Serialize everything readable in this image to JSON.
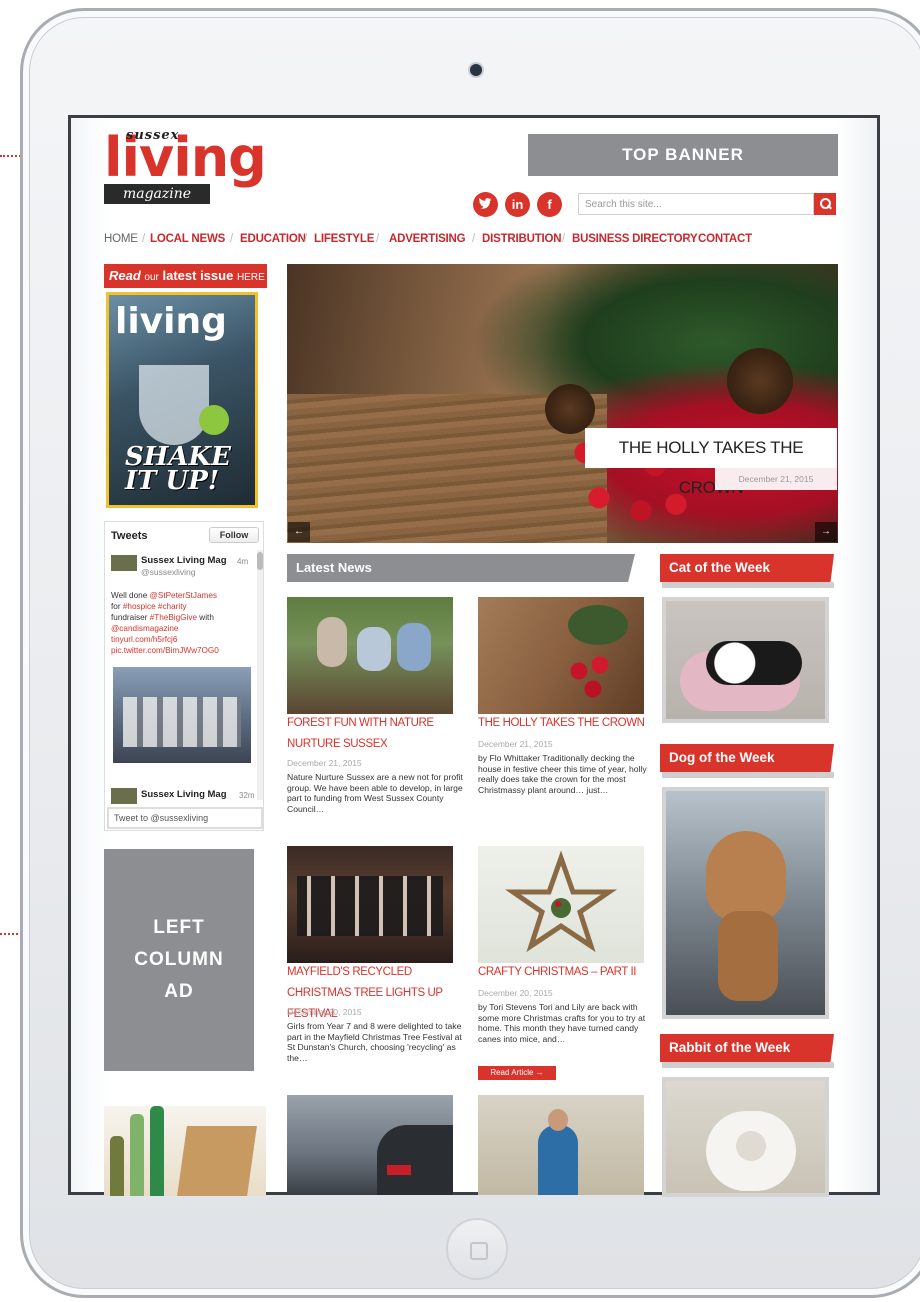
{
  "callouts": {
    "top_banner": "TOP BANNER",
    "left_column_ad": "LEFT\nCOLUMN\nAD"
  },
  "logo": {
    "sussex": "sussex",
    "living": "living",
    "magazine": "magazine"
  },
  "social": {
    "twitter_icon": "twitter-icon",
    "linkedin_icon": "linkedin-icon",
    "facebook_icon": "facebook-icon"
  },
  "search": {
    "placeholder": "Search this site..."
  },
  "nav": {
    "items": [
      "HOME",
      "LOCAL NEWS",
      "EDUCATION",
      "LIFESTYLE",
      "ADVERTISING",
      "DISTRIBUTION",
      "BUSINESS DIRECTORY",
      "CONTACT"
    ],
    "separator": "/"
  },
  "issue": {
    "read": "Read",
    "our": "our",
    "latest_issue": "latest issue",
    "here": "HERE",
    "cover_title": "living",
    "cover_shake": "SHAKE IT UP!"
  },
  "tweets": {
    "heading": "Tweets",
    "follow": "Follow",
    "tweet1_name": "Sussex Living Mag",
    "tweet1_time": "4m",
    "tweet1_handle": "@sussexliving",
    "tweet1_text_a": "Well done ",
    "tweet1_link1": "@StPeterStJames",
    "tweet1_text_b": "for ",
    "tweet1_link2": "#hospice #charity",
    "tweet1_text_c": "fundraiser ",
    "tweet1_link3": "#TheBigGive",
    "tweet1_text_d": " with",
    "tweet1_link4": "@candismagazine",
    "tweet1_link5": "tinyurl.com/h5rfcj6",
    "tweet1_link6": "pic.twitter.com/BimJWw7OG0",
    "tweet2_name": "Sussex Living Mag",
    "tweet2_time": "32m",
    "tweet_to": "Tweet to @sussexliving"
  },
  "hero": {
    "title": "THE HOLLY TAKES THE CROWN",
    "date": "December 21, 2015",
    "prev": "←",
    "next": "→"
  },
  "sections": {
    "latest_news": "Latest News",
    "cat": "Cat of the Week",
    "dog": "Dog of the Week",
    "rabbit": "Rabbit of the Week"
  },
  "articles": [
    {
      "title": "FOREST FUN WITH NATURE NURTURE SUSSEX",
      "date": "December 21, 2015",
      "excerpt": "Nature Nurture Sussex are a new not for profit group. We have been able to develop, in large part to funding from West Sussex County Council…"
    },
    {
      "title": "THE HOLLY TAKES THE CROWN",
      "date": "December 21, 2015",
      "excerpt": "by Flo Whittaker Traditionally decking the house in festive cheer this time of year, holly really does take the crown for the most Christmassy plant around… just…"
    },
    {
      "title": "MAYFIELD'S RECYCLED CHRISTMAS TREE LIGHTS UP FESTIVAL",
      "date": "December 20, 2015",
      "excerpt": "Girls from Year 7 and 8 were delighted to take part in the Mayfield Christmas Tree Festival at St Dunstan's Church, choosing 'recycling' as the…"
    },
    {
      "title": "CRAFTY CHRISTMAS – PART II",
      "date": "December 20, 2015",
      "excerpt": "by Tori Stevens Tori and Lily are back with some more Christmas crafts for you to try at home. This month they have turned candy canes into mice, and…"
    }
  ],
  "read_article": "Read Article →",
  "colors": {
    "brand_red": "#d8342c",
    "ad_gray": "#8c8e91"
  }
}
